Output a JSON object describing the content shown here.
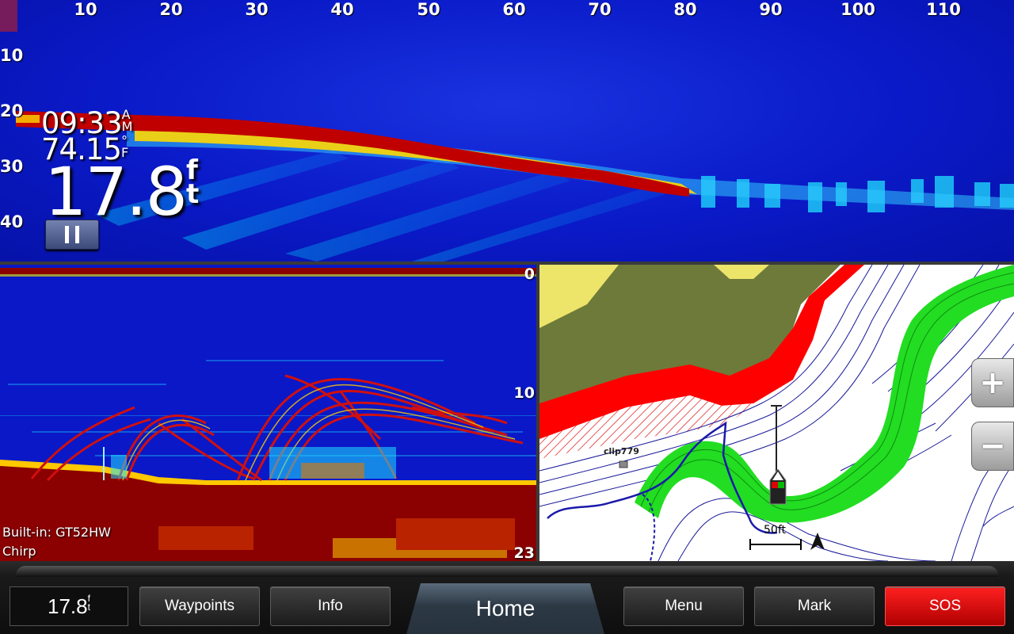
{
  "top_sonar": {
    "range_ticks": [
      "10",
      "20",
      "30",
      "40",
      "50",
      "60",
      "70",
      "80",
      "90",
      "100",
      "110"
    ],
    "depth_ticks": [
      "10",
      "20",
      "30",
      "40"
    ],
    "time": "09:33",
    "time_suffix_top": "A",
    "time_suffix_bottom": "M",
    "water_temp": "74.15",
    "temp_suffix_top": "°",
    "temp_suffix_bottom": "F",
    "depth": "17.8",
    "depth_suffix_top": "f",
    "depth_suffix_bottom": "t"
  },
  "chirp_sonar": {
    "scale_top": "0",
    "scale_mid": "10",
    "scale_bottom": "23",
    "transducer_line1": "Built-in: GT52HW",
    "transducer_line2": "Chirp"
  },
  "chart": {
    "waypoint_label": "clip779",
    "scale_label": "50ft",
    "zoom_in_symbol": "+",
    "zoom_out_symbol": "−"
  },
  "bottom_bar": {
    "depth_value": "17.8",
    "depth_suffix_top": "f",
    "depth_suffix_bottom": "t",
    "waypoints_label": "Waypoints",
    "info_label": "Info",
    "home_label": "Home",
    "menu_label": "Menu",
    "mark_label": "Mark",
    "sos_label": "SOS"
  },
  "colors": {
    "sonar_background": "#0a18c8",
    "bottom_return": "#8b0000",
    "chart_land": "#6e7a3a",
    "chart_shallow_red": "#ff0000",
    "chart_green_band": "#22dd22",
    "contour_lines": "#1a1a9a",
    "sos_red": "#e00000"
  }
}
